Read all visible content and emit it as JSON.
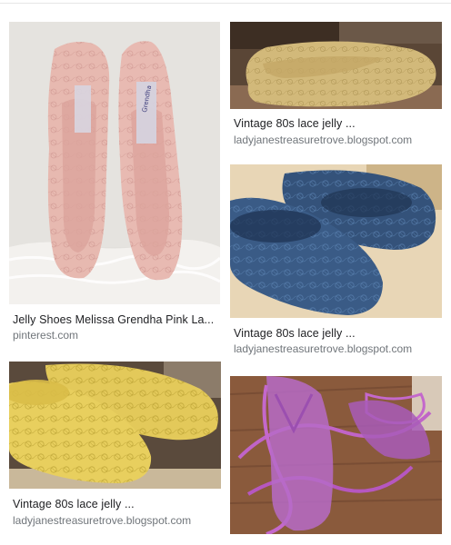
{
  "results": [
    {
      "title": "Jelly Shoes Melissa Grendha Pink La...",
      "source": "pinterest.com",
      "image": "pink-lace-jelly-heels",
      "shoe_label": "Grendha"
    },
    {
      "title": "Vintage 80s lace jelly ...",
      "source": "ladyjanestreasuretrove.blogspot.com",
      "image": "beige-lace-jelly-flat"
    },
    {
      "title": "Vintage 80s lace jelly ...",
      "source": "ladyjanestreasuretrove.blogspot.com",
      "image": "blue-lace-jelly-flats"
    },
    {
      "title": "Vintage 80s lace jelly ...",
      "source": "ladyjanestreasuretrove.blogspot.com",
      "image": "yellow-lace-jelly-flats"
    },
    {
      "title": "",
      "source": "",
      "image": "purple-jelly-sandals"
    }
  ]
}
